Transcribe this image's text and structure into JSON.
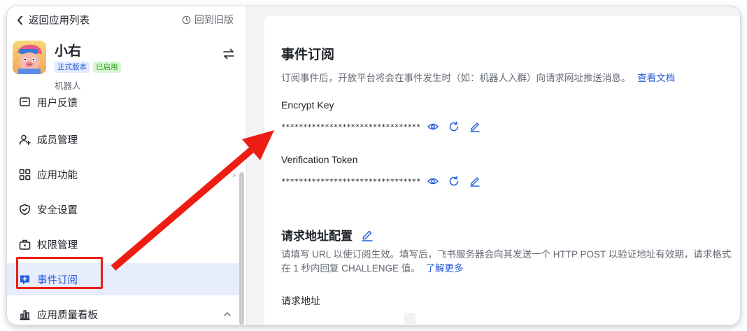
{
  "topbar": {
    "back_label": "返回应用列表",
    "old_version_label": "回到旧版"
  },
  "app": {
    "name": "小右",
    "badge_release": "正式版本",
    "badge_status": "已启用",
    "type": "机器人"
  },
  "nav": {
    "items": [
      {
        "label": "用户反馈",
        "icon": "feedback-icon"
      },
      {
        "label": "成员管理",
        "icon": "member-icon"
      },
      {
        "label": "应用功能",
        "icon": "grid-icon"
      },
      {
        "label": "安全设置",
        "icon": "shield-icon"
      },
      {
        "label": "权限管理",
        "icon": "briefcase-icon"
      },
      {
        "label": "事件订阅",
        "icon": "event-icon"
      },
      {
        "label": "应用质量看板",
        "icon": "bar-chart-icon"
      }
    ],
    "active_index": 5
  },
  "main": {
    "title": "事件订阅",
    "description": "订阅事件后，开放平台将会在事件发生时（如：机器人入群）向请求网址推送消息。",
    "doc_link": "查看文档",
    "encrypt_key": {
      "label": "Encrypt Key",
      "value": "********************************"
    },
    "verification_token": {
      "label": "Verification Token",
      "value": "********************************"
    },
    "request_section": {
      "title": "请求地址配置",
      "desc_line1": "请填写 URL 以使订阅生效。填写后，飞书服务器会向其发送一个 HTTP POST 以验证地址有效期，请求格式",
      "desc_line2": "在 1 秒内回复 CHALLENGE 值。",
      "learn_more": "了解更多",
      "url_label": "请求地址"
    }
  },
  "colors": {
    "accent": "#245bdb",
    "active_bg": "#e8edfd",
    "annotation_red": "#ee1d13",
    "badge_blue_bg": "#e1eaff",
    "badge_green_bg": "#d9f5d6",
    "badge_green_text": "#2ea121"
  }
}
